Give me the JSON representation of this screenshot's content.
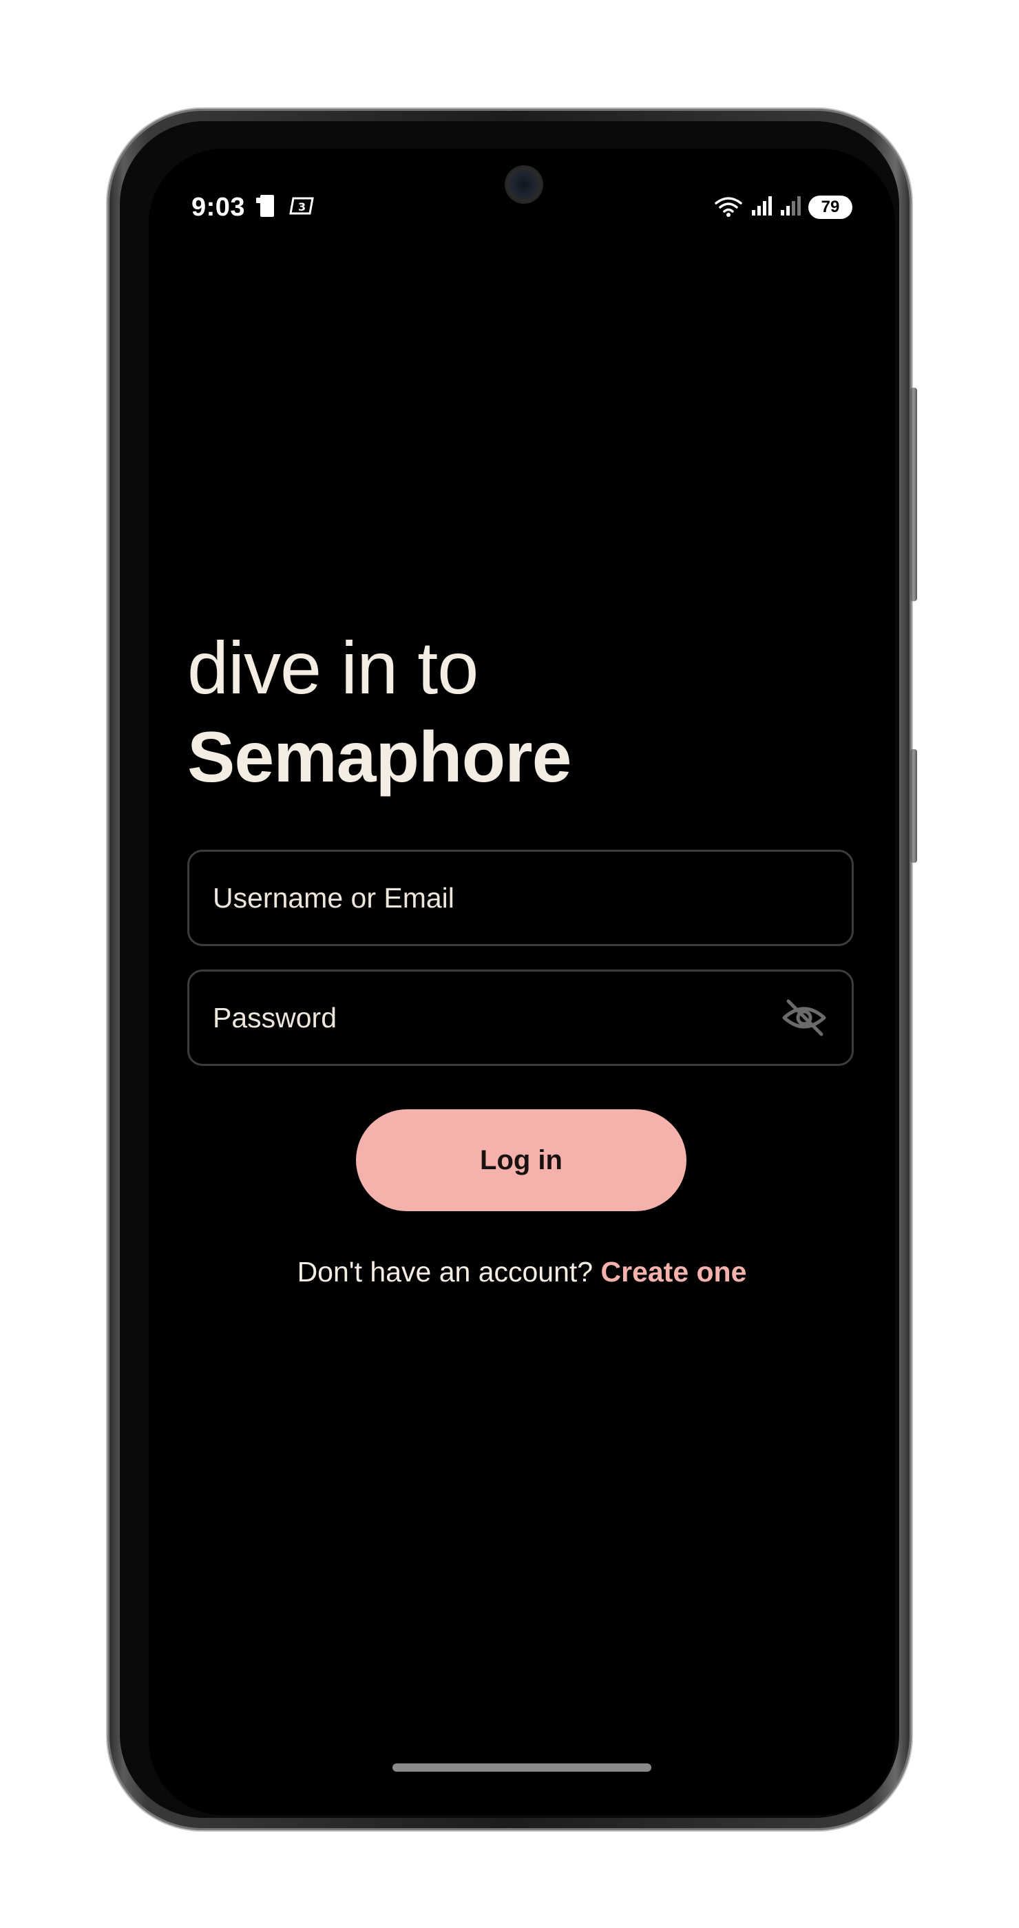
{
  "status_bar": {
    "time": "9:03",
    "battery": "79",
    "icons": [
      "notification-icon",
      "sim-card-icon",
      "wifi-icon",
      "signal-icon",
      "signal-icon"
    ]
  },
  "headline": {
    "line1": "dive in to",
    "line2": "Semaphore"
  },
  "form": {
    "username_placeholder": "Username or Email",
    "password_placeholder": "Password",
    "password_toggle_icon": "eye-off-icon"
  },
  "login_button": {
    "label": "Log in"
  },
  "signup": {
    "prompt": "Don't have an account?",
    "link": "Create one"
  },
  "colors": {
    "background": "#000000",
    "text": "#f4ede4",
    "accent": "#f5b2ad",
    "field_border": "#3c3c3c"
  }
}
